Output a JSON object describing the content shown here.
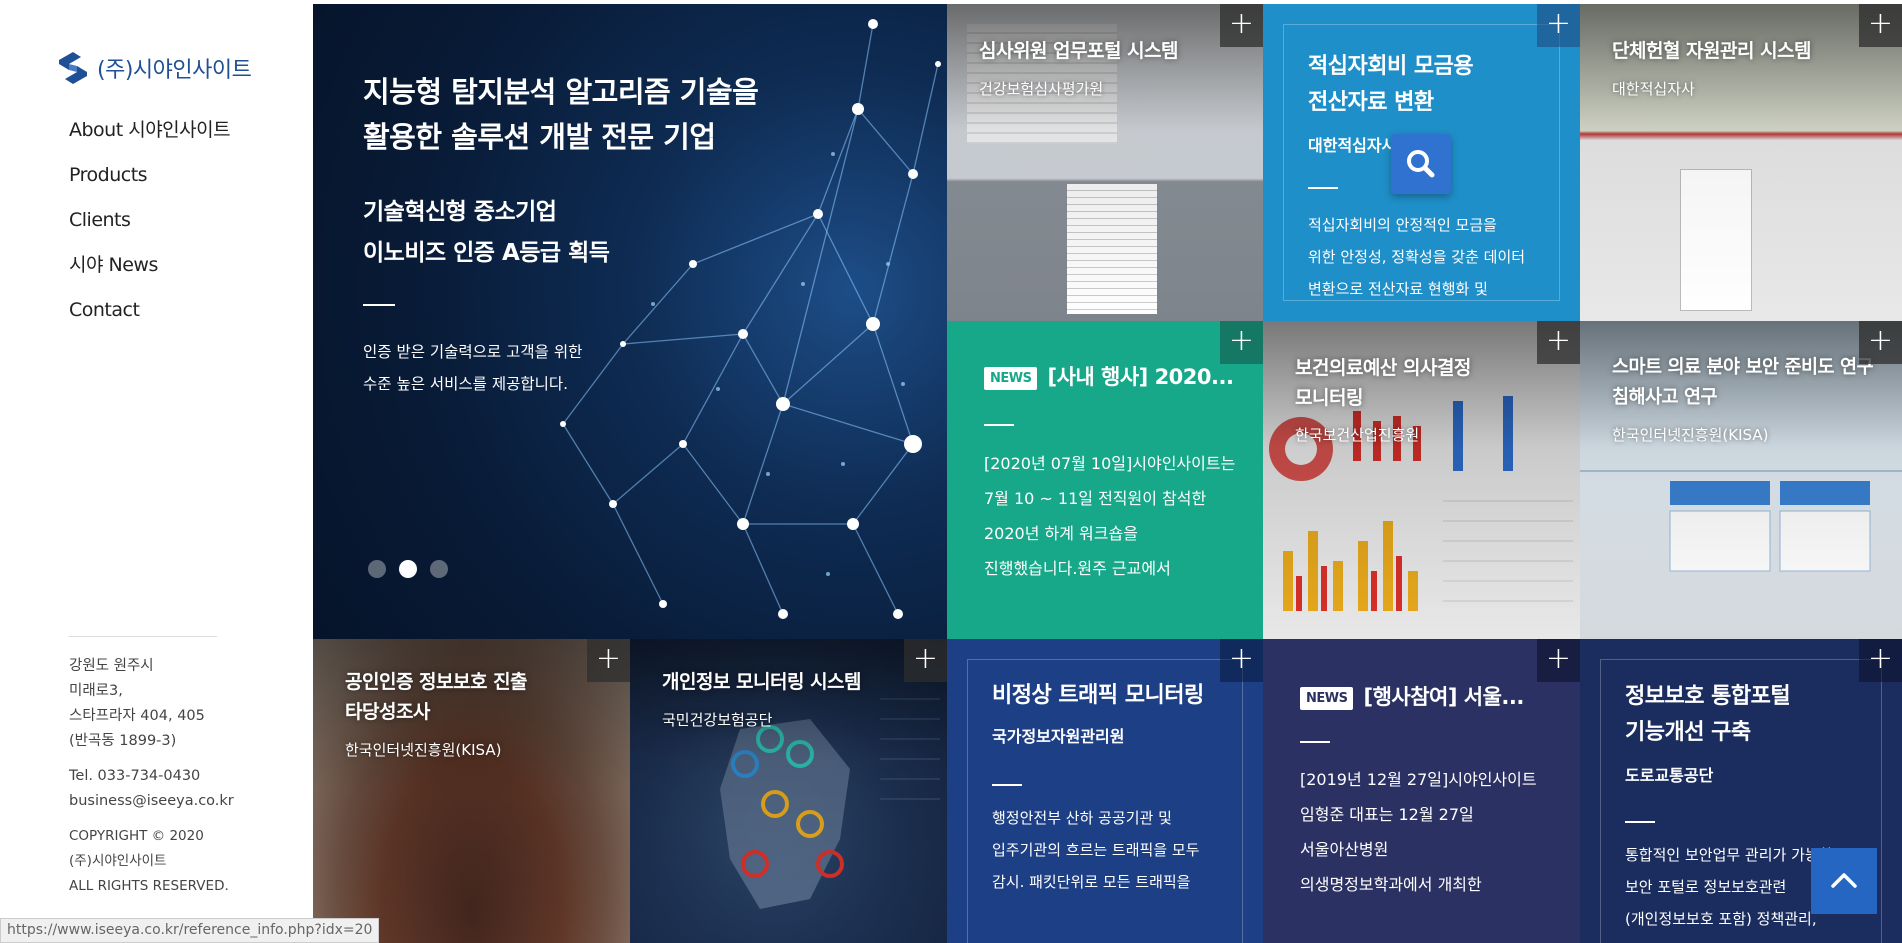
{
  "logo": {
    "text": "(주)시야인사이트"
  },
  "nav": [
    {
      "label": "About 시야인사이트"
    },
    {
      "label": "Products"
    },
    {
      "label": "Clients"
    },
    {
      "label": "시야 News"
    },
    {
      "label": "Contact"
    }
  ],
  "footer": {
    "address": [
      "강원도 원주시",
      "미래로3,",
      "스타프라자 404, 405",
      "(반곡동 1899-3)"
    ],
    "tel": "Tel. 033-734-0430",
    "email": "business@iseeya.co.kr",
    "copyright": [
      "COPYRIGHT © 2020",
      "(주)시야인사이트",
      "ALL RIGHTS RESERVED."
    ]
  },
  "status_url": "https://www.iseeya.co.kr/reference_info.php?idx=20",
  "hero": {
    "title_lines": [
      "지능형 탐지분석 알고리즘 기술을",
      "활용한 솔루션 개발 전문 기업"
    ],
    "sub_lines": [
      "기술혁신형 중소기업",
      "이노비즈 인증 A등급 획득"
    ],
    "desc_lines": [
      "인증 받은 기술력으로 고객을 위한",
      "수준 높은 서비스를 제공합니다."
    ],
    "slide_count": 3,
    "active_slide": 2
  },
  "plus_symbol": "+",
  "news_badge": "NEWS",
  "tiles": {
    "t1": {
      "title": "심사위원 업무포털 시스템",
      "client": "건강보험심사평가원"
    },
    "t2": {
      "title_lines": [
        "적십자회비 모금용",
        "전산자료 변환"
      ],
      "client": "대한적십자사",
      "desc_lines": [
        "적십자회비의 안정적인 모금을",
        "위한 안정성, 정확성을 갖춘 데이터",
        "변환으로 전산자료 현행화 및"
      ]
    },
    "t3": {
      "title": "단체헌혈 자원관리 시스템",
      "client": "대한적십자사"
    },
    "t4": {
      "headline": "[사내 행사] 2020...",
      "desc_lines": [
        "[2020년 07월 10일]시야인사이트는",
        "7월 10 ~ 11일 전직원이 참석한",
        "2020년 하계 워크숍을",
        "진행했습니다.원주 근교에서"
      ]
    },
    "t5": {
      "title_lines": [
        "보건의료예산 의사결정",
        "모니터링"
      ],
      "client": "한국보건산업진흥원"
    },
    "t6": {
      "title_lines": [
        "스마트 의료 분야 보안 준비도 연구",
        "침해사고 연구"
      ],
      "client": "한국인터넷진흥원(KISA)"
    },
    "t7": {
      "title_lines": [
        "공인인증 정보보호 진출",
        "타당성조사"
      ],
      "client": "한국인터넷진흥원(KISA)"
    },
    "t8": {
      "title": "개인정보 모니터링 시스템",
      "client": "국민건강보험공단"
    },
    "t9": {
      "title": "비정상 트래픽 모니터링",
      "client": "국가정보자원관리원",
      "desc_lines": [
        "행정안전부 산하 공공기관 및",
        "입주기관의 흐르는 트래픽을 모두",
        "감시. 패킷단위로 모든 트래픽을"
      ]
    },
    "t10": {
      "headline": "[행사참여] 서울...",
      "desc_lines": [
        "[2019년 12월 27일]시야인사이트",
        "임형준 대표는 12월 27일",
        "서울아산병원",
        "의생명정보학과에서 개최한"
      ]
    },
    "t11": {
      "title_lines": [
        "정보보호 통합포털",
        "기능개선 구축"
      ],
      "client": "도로교통공단",
      "desc_lines": [
        "통합적인 보안업무 관리가 가능한",
        "보안 포털로 정보보호관련",
        "(개인정보보호 포함) 정책관리,"
      ]
    }
  },
  "colors": {
    "brand_blue": "#1f4f95",
    "tile_blue": "#1f8fc9",
    "tile_green": "#17a889",
    "tile_navy": "#1c3f86",
    "tile_indigo": "#2b3162",
    "tile_dark_navy": "#1b2d5e",
    "top_button": "#2466c2"
  },
  "icons": [
    "logo-mark-icon",
    "plus-icon",
    "search-icon",
    "chevron-up-icon"
  ]
}
